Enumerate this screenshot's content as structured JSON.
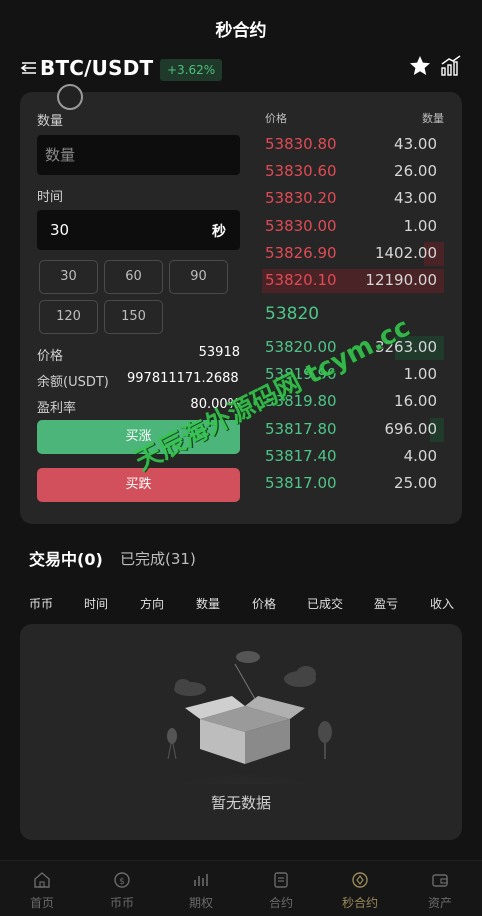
{
  "header": {
    "title": "秒合约",
    "pair": "BTC/USDT",
    "change": "+3.62%"
  },
  "form": {
    "quantity_label": "数量",
    "quantity_placeholder": "数量",
    "time_label": "时间",
    "time_value": "30",
    "time_unit": "秒",
    "time_options": [
      "30",
      "60",
      "90",
      "120",
      "150"
    ],
    "price_label": "价格",
    "price_value": "53918",
    "balance_label": "余额(USDT)",
    "balance_value": "997811171.2688",
    "profit_label": "盈利率",
    "profit_value": "80.00%",
    "buy_up_label": "买涨",
    "buy_down_label": "买跌"
  },
  "orderbook": {
    "price_header": "价格",
    "qty_header": "数量",
    "asks": [
      {
        "price": "53830.80",
        "qty": "43.00",
        "depth": 0
      },
      {
        "price": "53830.60",
        "qty": "26.00",
        "depth": 0
      },
      {
        "price": "53830.20",
        "qty": "43.00",
        "depth": 0
      },
      {
        "price": "53830.00",
        "qty": "1.00",
        "depth": 0
      },
      {
        "price": "53826.90",
        "qty": "1402.00",
        "depth": 0.11
      },
      {
        "price": "53820.10",
        "qty": "12190.00",
        "depth": 1.0
      }
    ],
    "last_price": "53820",
    "bids": [
      {
        "price": "53820.00",
        "qty": "3263.00",
        "depth": 0.27
      },
      {
        "price": "53819.90",
        "qty": "1.00",
        "depth": 0
      },
      {
        "price": "53819.80",
        "qty": "16.00",
        "depth": 0
      },
      {
        "price": "53817.80",
        "qty": "696.00",
        "depth": 0.06
      },
      {
        "price": "53817.40",
        "qty": "4.00",
        "depth": 0
      },
      {
        "price": "53817.00",
        "qty": "25.00",
        "depth": 0
      }
    ]
  },
  "trades": {
    "tab_active": "交易中(0)",
    "tab_done": "已完成(31)",
    "columns": [
      "币币",
      "时间",
      "方向",
      "数量",
      "价格",
      "已成交",
      "盈亏",
      "收入"
    ],
    "empty_text": "暂无数据"
  },
  "watermark": "天辰海外源码网 tcym.cc",
  "nav": [
    {
      "label": "首页",
      "icon": "home-icon"
    },
    {
      "label": "币币",
      "icon": "coin-icon"
    },
    {
      "label": "期权",
      "icon": "options-icon"
    },
    {
      "label": "合约",
      "icon": "contract-icon"
    },
    {
      "label": "秒合约",
      "icon": "second-contract-icon",
      "active": true
    },
    {
      "label": "资产",
      "icon": "wallet-icon"
    }
  ],
  "colors": {
    "up": "#4fc587",
    "down": "#e04b55",
    "background": "#131313",
    "panel": "#262626"
  }
}
